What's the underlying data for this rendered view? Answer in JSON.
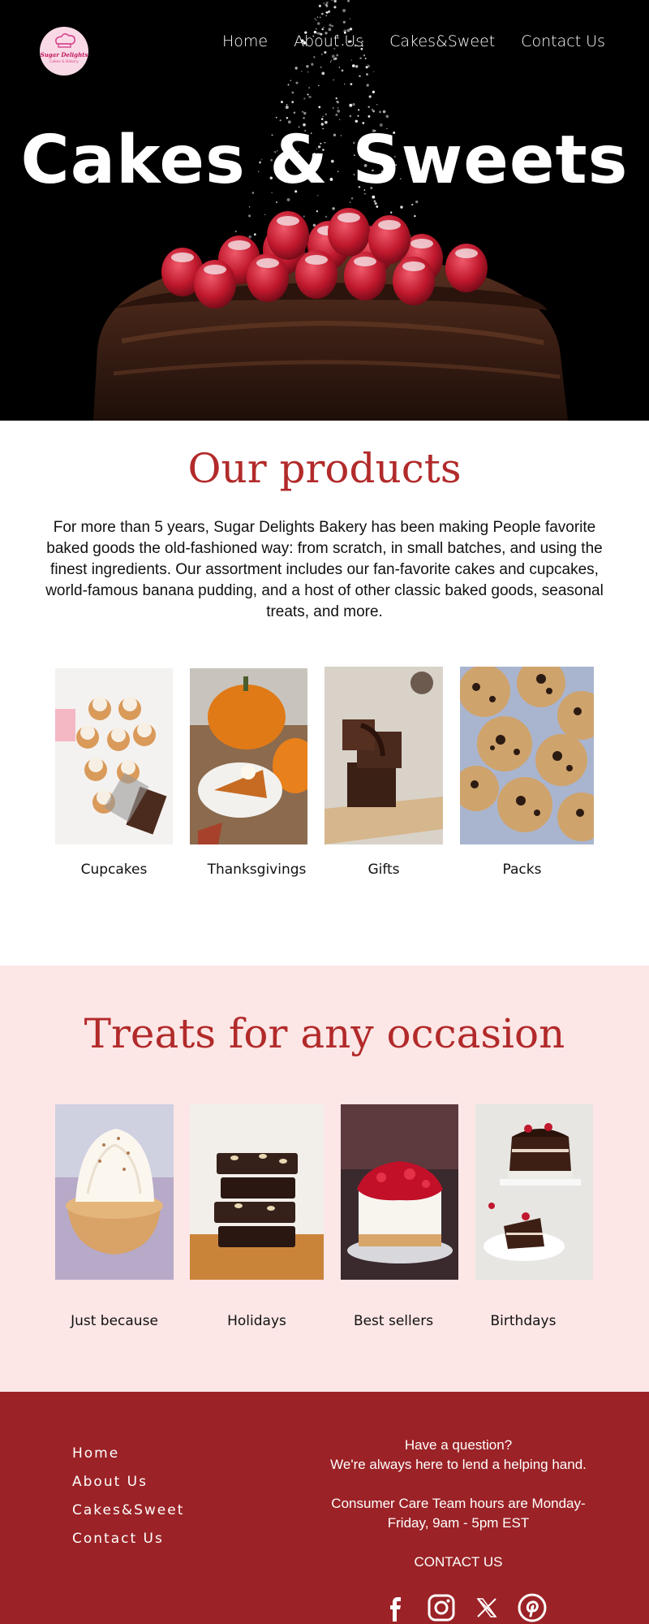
{
  "brand": {
    "logo_line1": "Sugar Delights",
    "logo_line2": "Cakes & Bakery"
  },
  "nav": [
    "Home",
    "About Us",
    "Cakes&Sweet",
    "Contact Us"
  ],
  "hero": {
    "title": "Cakes & Sweets"
  },
  "products": {
    "title": "Our products",
    "description": "For more than 5 years, Sugar Delights Bakery has been making People favorite baked goods the old-fashioned way: from scratch, in small batches, and using the finest ingredients. Our assortment includes our fan-favorite cakes and cupcakes, world-famous banana pudding, and a host of other classic baked goods, seasonal treats, and more.",
    "items": [
      {
        "label": "Cupcakes"
      },
      {
        "label": "Thanksgivings"
      },
      {
        "label": "Gifts"
      },
      {
        "label": "Packs"
      }
    ]
  },
  "treats": {
    "title": "Treats for any occasion",
    "items": [
      {
        "label": "Just because"
      },
      {
        "label": "Holidays"
      },
      {
        "label": "Best sellers"
      },
      {
        "label": "Birthdays"
      }
    ]
  },
  "footer": {
    "nav": [
      "Home",
      "About Us",
      "Cakes&Sweet",
      "Contact Us"
    ],
    "question": "Have a question?",
    "help": "We're always here to lend a helping hand.",
    "hours": "Consumer Care Team hours are Monday-Friday, 9am - 5pm EST",
    "contact_label": "CONTACT US",
    "social": [
      "facebook-icon",
      "instagram-icon",
      "x-icon",
      "pinterest-icon"
    ]
  },
  "colors": {
    "accent": "#b22a2a",
    "footer_bg": "#9b2226",
    "treats_bg": "#fde6e6",
    "logo_pink": "#d6418b"
  }
}
